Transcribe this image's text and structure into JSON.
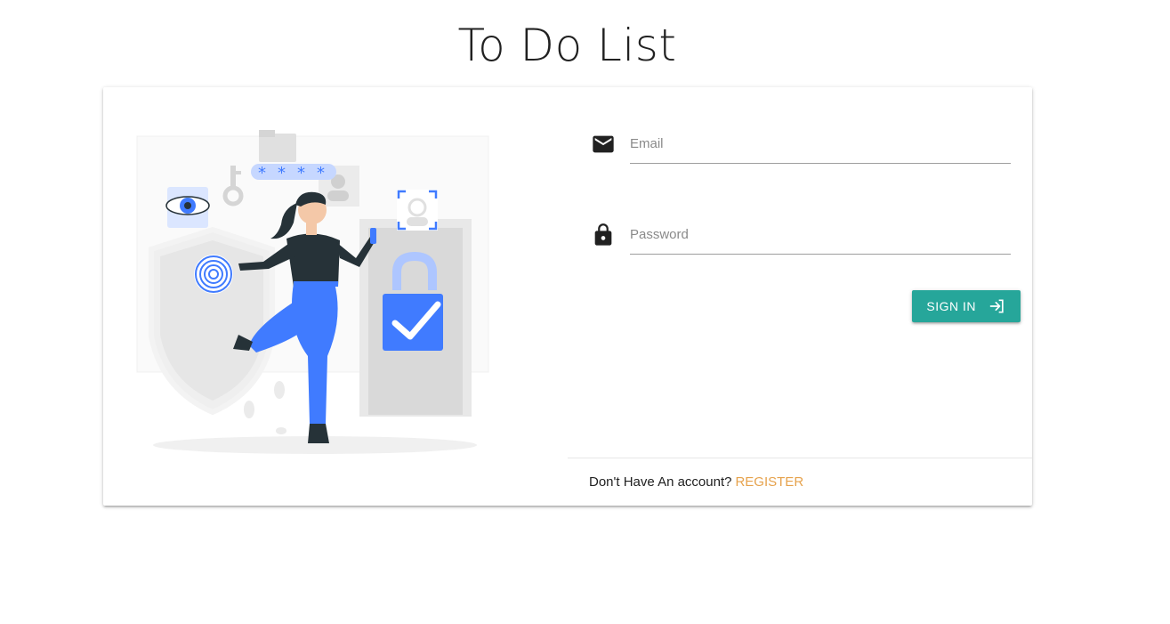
{
  "page": {
    "title": "To Do List"
  },
  "form": {
    "email": {
      "placeholder": "Email",
      "value": "",
      "icon": "email-icon"
    },
    "password": {
      "placeholder": "Password",
      "value": "",
      "icon": "lock-icon"
    },
    "signin": {
      "label": "SIGN IN",
      "icon": "login-icon"
    }
  },
  "footer": {
    "prompt": "Don't Have An account?",
    "register_label": "REGISTER"
  },
  "colors": {
    "accent": "#26a69a",
    "link": "#e6a24c",
    "illustration_blue": "#407bff"
  }
}
